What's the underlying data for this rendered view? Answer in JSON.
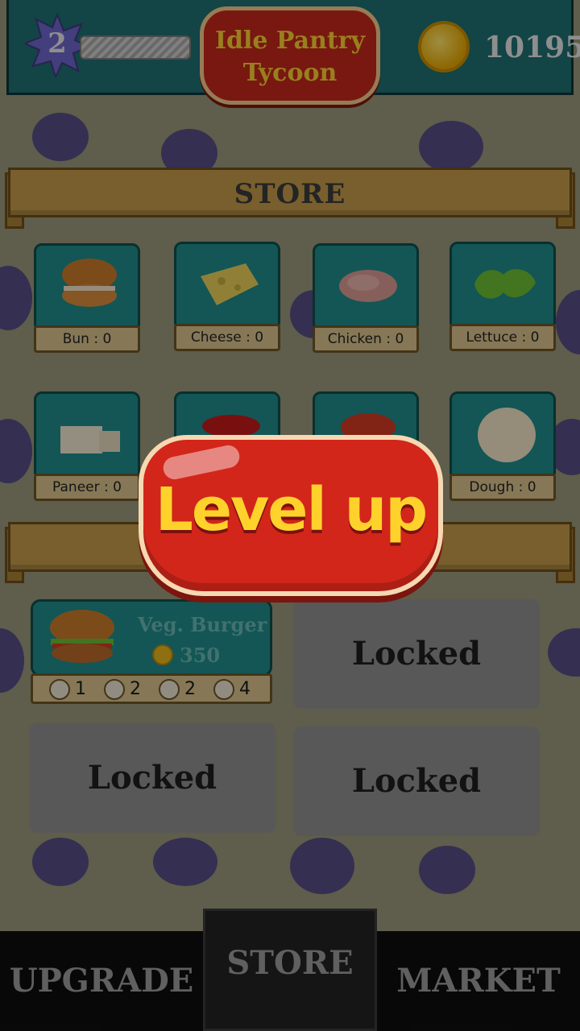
{
  "header": {
    "level": "2",
    "title_line1": "Idle Pantry",
    "title_line2": "Tycoon",
    "coins": "10195"
  },
  "store_ribbon": "STORE",
  "store_items": [
    {
      "label": "Bun : 0",
      "icon": "bun-icon"
    },
    {
      "label": "Cheese : 0",
      "icon": "cheese-icon"
    },
    {
      "label": "Chicken : 0",
      "icon": "chicken-icon"
    },
    {
      "label": "Lettuce : 0",
      "icon": "lettuce-icon"
    },
    {
      "label": "Paneer : 0",
      "icon": "paneer-icon"
    },
    {
      "label": "",
      "icon": "sauce-icon"
    },
    {
      "label": "",
      "icon": "tomato-icon"
    },
    {
      "label": "Dough : 0",
      "icon": "dough-icon"
    }
  ],
  "recipes": {
    "unlocked": {
      "name": "Veg. Burger",
      "price": "350",
      "ingredients": [
        {
          "icon": "bun-icon",
          "count": "1"
        },
        {
          "icon": "cheese-icon",
          "count": "2"
        },
        {
          "icon": "lettuce-icon",
          "count": "2"
        },
        {
          "icon": "tomato-icon",
          "count": "4"
        }
      ]
    },
    "locked_label": "Locked"
  },
  "popup": {
    "text": "Level up"
  },
  "nav": {
    "upgrade": "UPGRADE",
    "store": "STORE",
    "market": "MARKET"
  },
  "colors": {
    "teal": "#1f8c8a",
    "ribbon": "#c29a4a",
    "popup_red": "#d2261a",
    "popup_text": "#ffd22b"
  }
}
